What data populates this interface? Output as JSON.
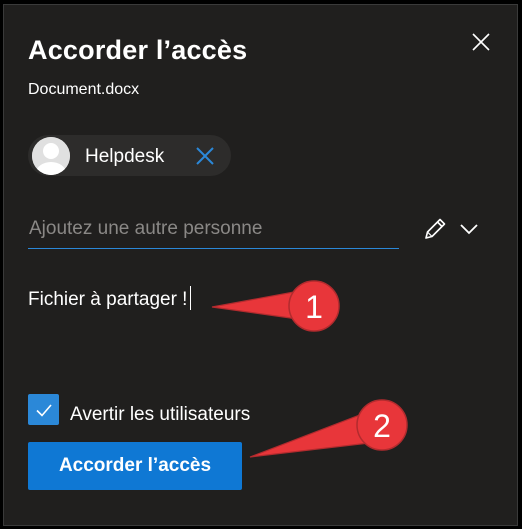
{
  "dialog": {
    "title": "Accorder l’accès",
    "filename": "Document.docx"
  },
  "recipient": {
    "name": "Helpdesk"
  },
  "add_person": {
    "placeholder": "Ajoutez une autre personne"
  },
  "permissions": {
    "icon": "pencil-icon"
  },
  "message": {
    "value": "Fichier à partager !"
  },
  "notify": {
    "label": "Avertir les utilisateurs",
    "checked": true
  },
  "primary_button": {
    "label": "Accorder l’accès"
  },
  "annotations": [
    {
      "number": "1"
    },
    {
      "number": "2"
    }
  ],
  "colors": {
    "dialog_bg": "#201f1e",
    "accent": "#0f78d4",
    "checkbox": "#2b88d8",
    "annotation_red": "#e8363a"
  }
}
